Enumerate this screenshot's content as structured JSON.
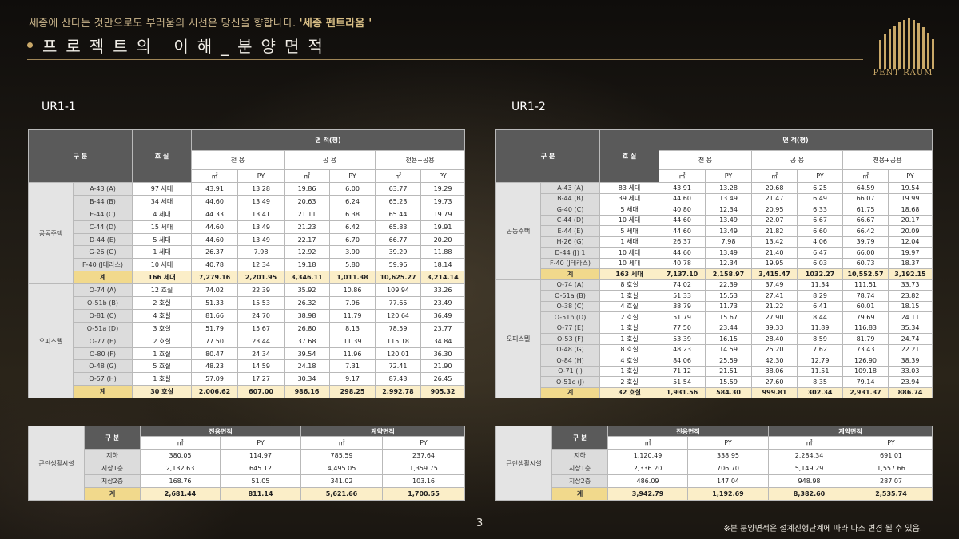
{
  "header": {
    "tagline_plain": "세종에 산다는 것만으로도 부러움의 시선은 당신을 향합니다. ",
    "tagline_brand": "'세종 펜트라움 '",
    "title": "프로젝트의 이해_분양면적",
    "logo_text": "PENT RAUM"
  },
  "labels": {
    "gubun": "구 분",
    "hosil": "호 실",
    "area": "면 적(평)",
    "excl": "전 용",
    "common": "공 용",
    "excl_common": "전용+공용",
    "sqm": "㎡",
    "py": "PY",
    "sum": "계",
    "excl_area": "전용면적",
    "contract_area": "계약면적"
  },
  "ur1_1": {
    "title": "UR1-1",
    "groups": [
      {
        "name": "공동주택",
        "rows": [
          [
            "A-43 (A)",
            "97 세대",
            "43.91",
            "13.28",
            "19.86",
            "6.00",
            "63.77",
            "19.29"
          ],
          [
            "B-44 (B)",
            "34 세대",
            "44.60",
            "13.49",
            "20.63",
            "6.24",
            "65.23",
            "19.73"
          ],
          [
            "E-44 (C)",
            "4 세대",
            "44.33",
            "13.41",
            "21.11",
            "6.38",
            "65.44",
            "19.79"
          ],
          [
            "C-44 (D)",
            "15 세대",
            "44.60",
            "13.49",
            "21.23",
            "6.42",
            "65.83",
            "19.91"
          ],
          [
            "D-44 (E)",
            "5 세대",
            "44.60",
            "13.49",
            "22.17",
            "6.70",
            "66.77",
            "20.20"
          ],
          [
            "G-26 (G)",
            "1 세대",
            "26.37",
            "7.98",
            "12.92",
            "3.90",
            "39.29",
            "11.88"
          ],
          [
            "F-40 (J테라스)",
            "10 세대",
            "40.78",
            "12.34",
            "19.18",
            "5.80",
            "59.96",
            "18.14"
          ]
        ],
        "total": [
          "166 세대",
          "7,279.16",
          "2,201.95",
          "3,346.11",
          "1,011.38",
          "10,625.27",
          "3,214.14"
        ]
      },
      {
        "name": "오피스텔",
        "rows": [
          [
            "O-74 (A)",
            "12 호실",
            "74.02",
            "22.39",
            "35.92",
            "10.86",
            "109.94",
            "33.26"
          ],
          [
            "O-51b (B)",
            "2 호실",
            "51.33",
            "15.53",
            "26.32",
            "7.96",
            "77.65",
            "23.49"
          ],
          [
            "O-81 (C)",
            "4 호실",
            "81.66",
            "24.70",
            "38.98",
            "11.79",
            "120.64",
            "36.49"
          ],
          [
            "O-51a (D)",
            "3 호실",
            "51.79",
            "15.67",
            "26.80",
            "8.13",
            "78.59",
            "23.77"
          ],
          [
            "O-77 (E)",
            "2 호실",
            "77.50",
            "23.44",
            "37.68",
            "11.39",
            "115.18",
            "34.84"
          ],
          [
            "O-80 (F)",
            "1 호실",
            "80.47",
            "24.34",
            "39.54",
            "11.96",
            "120.01",
            "36.30"
          ],
          [
            "O-48 (G)",
            "5 호실",
            "48.23",
            "14.59",
            "24.18",
            "7.31",
            "72.41",
            "21.90"
          ],
          [
            "O-57 (H)",
            "1 호실",
            "57.09",
            "17.27",
            "30.34",
            "9.17",
            "87.43",
            "26.45"
          ]
        ],
        "total": [
          "30 호실",
          "2,006.62",
          "607.00",
          "986.16",
          "298.25",
          "2,992.78",
          "905.32"
        ]
      }
    ],
    "retail": {
      "name": "근린생활시설",
      "rows": [
        [
          "지하",
          "380.05",
          "114.97",
          "785.59",
          "237.64"
        ],
        [
          "지상1층",
          "2,132.63",
          "645.12",
          "4,495.05",
          "1,359.75"
        ],
        [
          "지상2층",
          "168.76",
          "51.05",
          "341.02",
          "103.16"
        ]
      ],
      "total": [
        "2,681.44",
        "811.14",
        "5,621.66",
        "1,700.55"
      ]
    }
  },
  "ur1_2": {
    "title": "UR1-2",
    "groups": [
      {
        "name": "공동주택",
        "rows": [
          [
            "A-43 (A)",
            "83 세대",
            "43.91",
            "13.28",
            "20.68",
            "6.25",
            "64.59",
            "19.54"
          ],
          [
            "B-44 (B)",
            "39 세대",
            "44.60",
            "13.49",
            "21.47",
            "6.49",
            "66.07",
            "19.99"
          ],
          [
            "G-40 (C)",
            "5 세대",
            "40.80",
            "12.34",
            "20.95",
            "6.33",
            "61.75",
            "18.68"
          ],
          [
            "C-44 (D)",
            "10 세대",
            "44.60",
            "13.49",
            "22.07",
            "6.67",
            "66.67",
            "20.17"
          ],
          [
            "E-44 (E)",
            "5 세대",
            "44.60",
            "13.49",
            "21.82",
            "6.60",
            "66.42",
            "20.09"
          ],
          [
            "H-26 (G)",
            "1 세대",
            "26.37",
            "7.98",
            "13.42",
            "4.06",
            "39.79",
            "12.04"
          ],
          [
            "D-44 (J) 1",
            "10 세대",
            "44.60",
            "13.49",
            "21.40",
            "6.47",
            "66.00",
            "19.97"
          ],
          [
            "F-40 (J테라스)",
            "10 세대",
            "40.78",
            "12.34",
            "19.95",
            "6.03",
            "60.73",
            "18.37"
          ]
        ],
        "total": [
          "163 세대",
          "7,137.10",
          "2,158.97",
          "3,415.47",
          "1032.27",
          "10,552.57",
          "3,192.15"
        ]
      },
      {
        "name": "오피스텔",
        "rows": [
          [
            "O-74 (A)",
            "8 호실",
            "74.02",
            "22.39",
            "37.49",
            "11.34",
            "111.51",
            "33.73"
          ],
          [
            "O-51a (B)",
            "1 호실",
            "51.33",
            "15.53",
            "27.41",
            "8.29",
            "78.74",
            "23.82"
          ],
          [
            "O-38 (C)",
            "4 호실",
            "38.79",
            "11.73",
            "21.22",
            "6.41",
            "60.01",
            "18.15"
          ],
          [
            "O-51b (D)",
            "2 호실",
            "51.79",
            "15.67",
            "27.90",
            "8.44",
            "79.69",
            "24.11"
          ],
          [
            "O-77 (E)",
            "1 호실",
            "77.50",
            "23.44",
            "39.33",
            "11.89",
            "116.83",
            "35.34"
          ],
          [
            "O-53 (F)",
            "1 호실",
            "53.39",
            "16.15",
            "28.40",
            "8.59",
            "81.79",
            "24.74"
          ],
          [
            "O-48 (G)",
            "8 호실",
            "48.23",
            "14.59",
            "25.20",
            "7.62",
            "73.43",
            "22.21"
          ],
          [
            "O-84 (H)",
            "4 호실",
            "84.06",
            "25.59",
            "42.30",
            "12.79",
            "126.90",
            "38.39"
          ],
          [
            "O-71 (I)",
            "1 호실",
            "71.12",
            "21.51",
            "38.06",
            "11.51",
            "109.18",
            "33.03"
          ],
          [
            "O-51c (J)",
            "2 호실",
            "51.54",
            "15.59",
            "27.60",
            "8.35",
            "79.14",
            "23.94"
          ]
        ],
        "total": [
          "32 호실",
          "1,931.56",
          "584.30",
          "999.81",
          "302.34",
          "2,931.37",
          "886.74"
        ]
      }
    ],
    "retail": {
      "name": "근린생활시설",
      "rows": [
        [
          "지하",
          "1,120.49",
          "338.95",
          "2,284.34",
          "691.01"
        ],
        [
          "지상1층",
          "2,336.20",
          "706.70",
          "5,149.29",
          "1,557.66"
        ],
        [
          "지상2층",
          "486.09",
          "147.04",
          "948.98",
          "287.07"
        ]
      ],
      "total": [
        "3,942.79",
        "1,192.69",
        "8,382.60",
        "2,535.74"
      ]
    }
  },
  "footer": {
    "page_number": "3",
    "note": "※본 분양면적은 설계진행단계에 따라 다소 변경 될 수 있음."
  }
}
